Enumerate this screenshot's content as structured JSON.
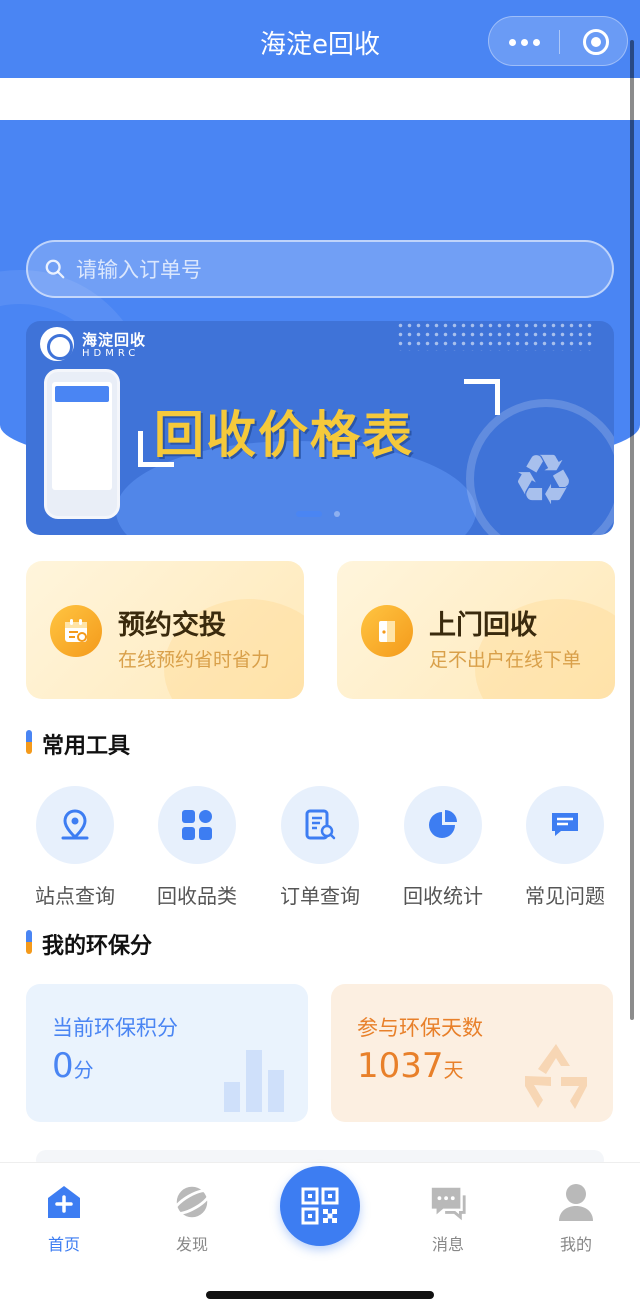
{
  "app": {
    "title": "海淀e回收"
  },
  "search": {
    "placeholder": "请输入订单号"
  },
  "banner": {
    "brand": "海淀回收",
    "brand_sub": "HDMRC",
    "headline": "回收价格表"
  },
  "actions": [
    {
      "title": "预约交投",
      "subtitle": "在线预约省时省力",
      "icon": "calendar-icon"
    },
    {
      "title": "上门回收",
      "subtitle": "足不出户在线下单",
      "icon": "door-icon"
    }
  ],
  "tools_section": {
    "title": "常用工具"
  },
  "tools": [
    {
      "label": "站点查询",
      "icon": "location-pin-icon"
    },
    {
      "label": "回收品类",
      "icon": "category-grid-icon"
    },
    {
      "label": "订单查询",
      "icon": "order-search-icon"
    },
    {
      "label": "回收统计",
      "icon": "pie-chart-icon"
    },
    {
      "label": "常见问题",
      "icon": "chat-faq-icon"
    }
  ],
  "score_section": {
    "title": "我的环保分"
  },
  "scores": [
    {
      "label": "当前环保积分",
      "value": "0",
      "unit": "分",
      "color": "#4a85f3"
    },
    {
      "label": "参与环保天数",
      "value": "1037",
      "unit": "天",
      "color": "#e8802a"
    }
  ],
  "tabbar": {
    "items": [
      {
        "label": "首页",
        "icon": "home-plus-icon",
        "active": true
      },
      {
        "label": "发现",
        "icon": "planet-icon",
        "active": false
      },
      {
        "label": "",
        "icon": "qr-code-icon",
        "active": false
      },
      {
        "label": "消息",
        "icon": "message-icon",
        "active": false
      },
      {
        "label": "我的",
        "icon": "user-icon",
        "active": false
      }
    ]
  },
  "colors": {
    "primary": "#4a85f3",
    "accent": "#f49a1b",
    "banner_text": "#f5c93b"
  }
}
